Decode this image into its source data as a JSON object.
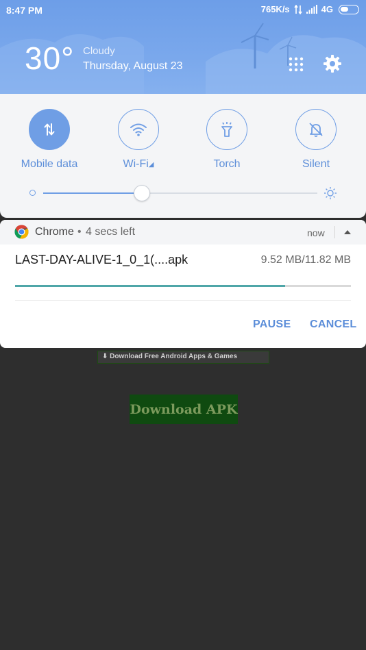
{
  "status_bar": {
    "time": "8:47 PM",
    "speed": "765K/s",
    "network": "4G"
  },
  "weather": {
    "temperature": "30°",
    "condition": "Cloudy",
    "date": "Thursday, August 23"
  },
  "quick_settings": {
    "toggles": [
      {
        "label": "Mobile data",
        "icon": "mobile-data-icon",
        "active": true
      },
      {
        "label": "Wi-Fi",
        "icon": "wifi-icon",
        "active": false
      },
      {
        "label": "Torch",
        "icon": "torch-icon",
        "active": false
      },
      {
        "label": "Silent",
        "icon": "silent-bell-icon",
        "active": false
      }
    ],
    "brightness_level": 0.36
  },
  "notification": {
    "app": "Chrome",
    "separator": "•",
    "eta": "4 secs left",
    "time": "now",
    "filename": "LAST-DAY-ALIVE-1_0_1(....apk",
    "size": "9.52 MB/11.82 MB",
    "progress": 0.805,
    "actions": {
      "pause": "PAUSE",
      "cancel": "CANCEL"
    }
  },
  "background_page": {
    "banner_text": "Download Free Android Apps & Games",
    "download_button": "Download APK"
  },
  "colors": {
    "accent": "#6f9ee5",
    "label_blue": "#5c8ed9",
    "progress": "#4fa6a8",
    "header_top": "#6d9ee8"
  }
}
